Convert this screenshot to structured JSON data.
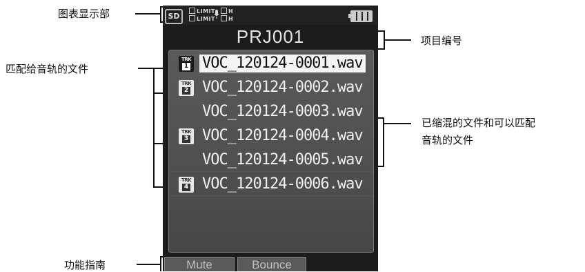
{
  "callouts": {
    "display": "图表显示部",
    "project_number": "项目编号",
    "matched_files": "匹配给音轨的文件",
    "mixed_files": "已缩混的文件和可以匹配\n音轨的文件",
    "mixed_line1": "已缩混的文件和可以匹配",
    "mixed_line2": "音轨的文件",
    "function_guide": "功能指南"
  },
  "status": {
    "sd_label": "SD",
    "limit_top": "LIMIT",
    "limit_bottom": "LIMIT",
    "level_top": "H",
    "level_bottom": "H",
    "icons": [
      "sd-card-icon",
      "limiter-icon",
      "mic-icon",
      "battery-icon"
    ]
  },
  "project_title": "PRJ001",
  "files": [
    {
      "name": "VOC_120124-0001.wav",
      "track": "1",
      "selected": true
    },
    {
      "name": "VOC_120124-0002.wav",
      "track": "2",
      "selected": false
    },
    {
      "name": "VOC_120124-0003.wav",
      "track": "",
      "selected": false
    },
    {
      "name": "VOC_120124-0004.wav",
      "track": "3",
      "selected": false
    },
    {
      "name": "VOC_120124-0005.wav",
      "track": "",
      "selected": false
    },
    {
      "name": "VOC_120124-0006.wav",
      "track": "4",
      "selected": false
    }
  ],
  "trk_label": "TRK",
  "guide": {
    "mute_label": "Mute",
    "bounce_label": "Bounce"
  },
  "colors": {
    "screen_bg": "#1c1c1c",
    "panel_bg": "#4f4f4f",
    "selected_bg": "#f4f4f4",
    "text_light": "#f0f0f0"
  }
}
